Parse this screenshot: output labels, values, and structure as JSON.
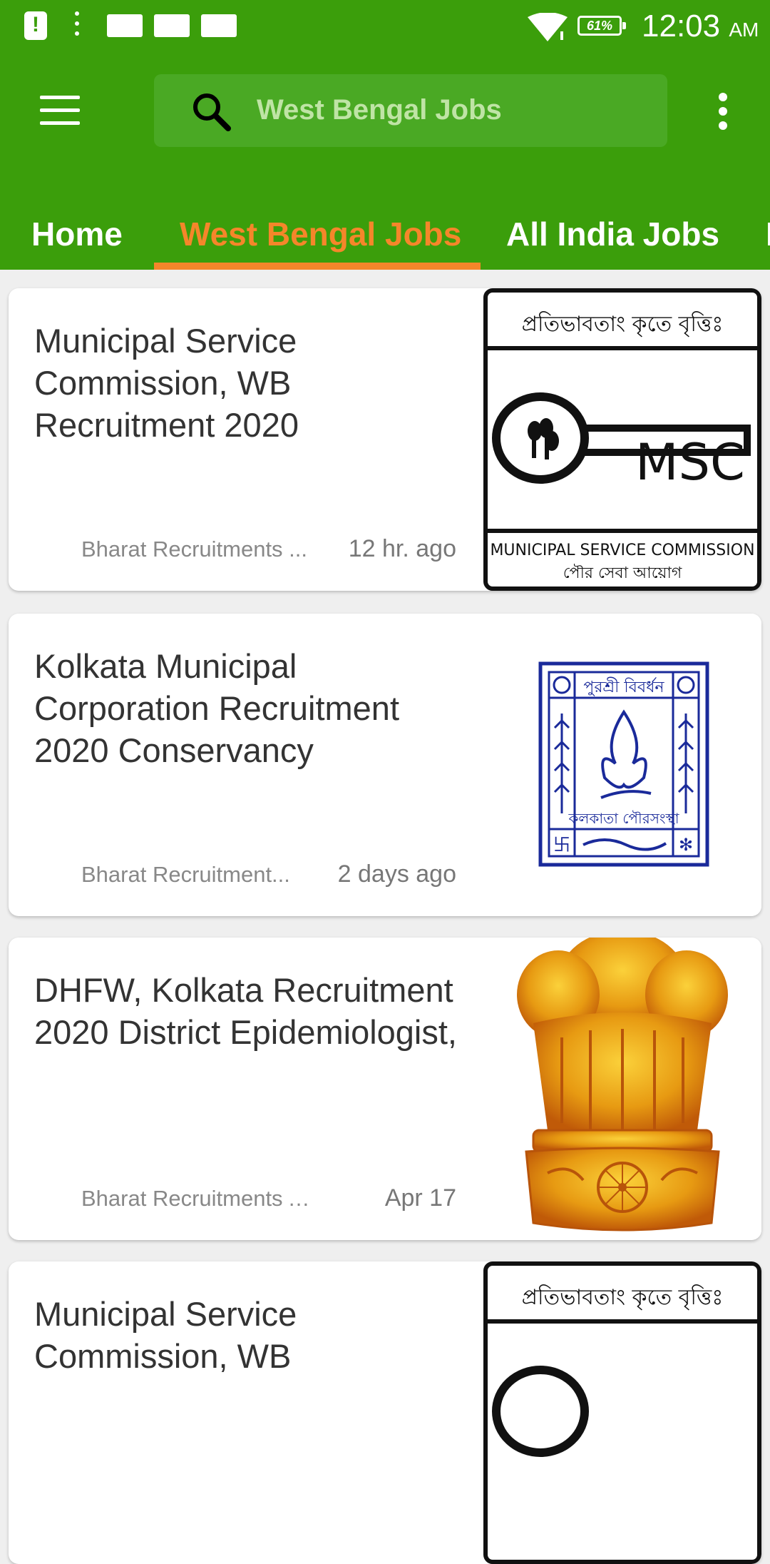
{
  "status_bar": {
    "battery": "61%",
    "time": "12:03",
    "ampm": "AM"
  },
  "app_bar": {
    "search_placeholder": "West Bengal Jobs"
  },
  "tabs": [
    {
      "label": "Home",
      "active": false
    },
    {
      "label": "West Bengal Jobs",
      "active": true
    },
    {
      "label": "All India Jobs",
      "active": false
    }
  ],
  "colors": {
    "primary": "#3b9e0b",
    "accent": "#f5862a"
  },
  "cards": [
    {
      "title": "Municipal Service Commission, WB Recruitment 2020",
      "source": "Bharat Recruitments ...",
      "time": "12 hr. ago",
      "image": "msc-logo",
      "logo_top_text": "প্রতিভাবতাং কৃতে বৃত্তিঃ",
      "logo_mid_text": "MSC",
      "logo_bottom_text_1": "MUNICIPAL SERVICE COMMISSION",
      "logo_bottom_text_2": "পৌর সেবা আয়োগ"
    },
    {
      "title": "Kolkata Municipal Corporation Recruitment 2020 Conservancy",
      "source": "Bharat Recruitment...",
      "time": "2 days ago",
      "image": "kmc-logo",
      "logo_top_text": "পুরশ্রী বিবর্ধন",
      "logo_bottom_text": "কলকাতা পৌরসংস্থা"
    },
    {
      "title": "DHFW, Kolkata Recruitment 2020 District Epidemiologist,",
      "source": "Bharat Recruitments All I...",
      "time": "Apr 17",
      "image": "ashoka-emblem"
    },
    {
      "title": "Municipal Service Commission, WB",
      "image": "msc-logo",
      "logo_top_text": "প্রতিভাবতাং কৃতে বৃত্তিঃ"
    }
  ]
}
